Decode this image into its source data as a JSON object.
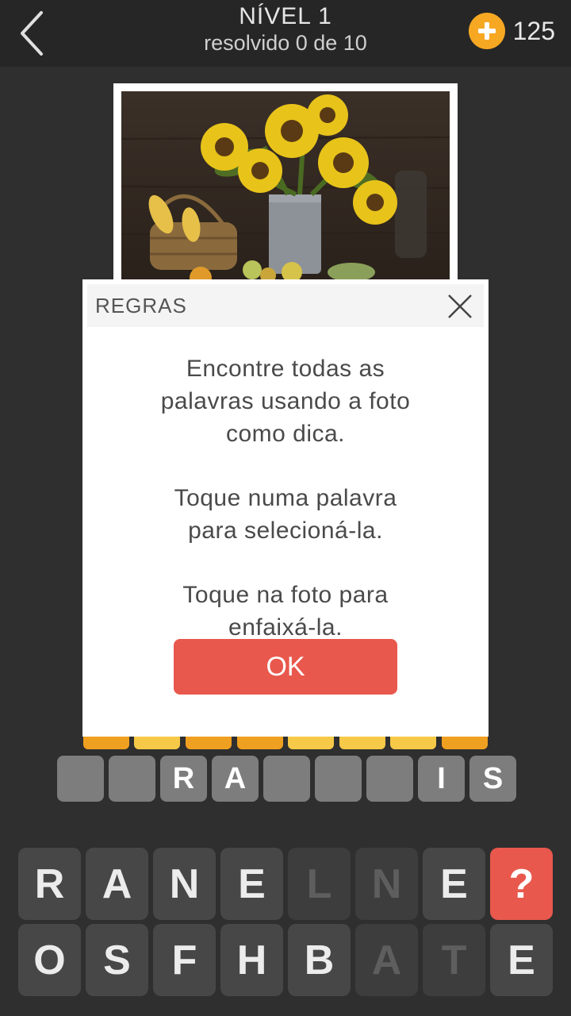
{
  "header": {
    "level_title": "NÍVEL 1",
    "progress_text": "resolvido 0 de 10",
    "coin_count": "125"
  },
  "modal": {
    "title": "REGRAS",
    "paragraphs": [
      "Encontre todas as palavras usando a foto como dica.",
      "Toque numa palavra para selecioná-la.",
      "Toque na foto para enfaixá-la."
    ],
    "ok_label": "OK"
  },
  "answer_slots": [
    "",
    "",
    "R",
    "A",
    "",
    "",
    "",
    "I",
    "S"
  ],
  "keyboard": {
    "row1": [
      {
        "letter": "R",
        "used": false
      },
      {
        "letter": "A",
        "used": false
      },
      {
        "letter": "N",
        "used": false
      },
      {
        "letter": "E",
        "used": false
      },
      {
        "letter": "L",
        "used": true
      },
      {
        "letter": "N",
        "used": true
      },
      {
        "letter": "E",
        "used": false
      },
      {
        "letter": "?",
        "hint": true
      }
    ],
    "row2": [
      {
        "letter": "O",
        "used": false
      },
      {
        "letter": "S",
        "used": false
      },
      {
        "letter": "F",
        "used": false
      },
      {
        "letter": "H",
        "used": false
      },
      {
        "letter": "B",
        "used": false
      },
      {
        "letter": "A",
        "used": true
      },
      {
        "letter": "T",
        "used": true
      },
      {
        "letter": "E",
        "used": false
      }
    ]
  },
  "colors": {
    "accent_red": "#e8584d",
    "coin_orange": "#f7a823",
    "strip_orange": "#f0a020",
    "strip_yellow": "#f7c948"
  }
}
